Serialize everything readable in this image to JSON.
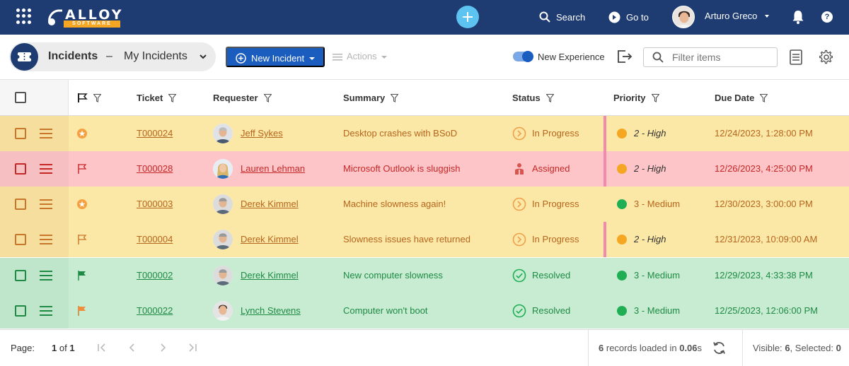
{
  "topbar": {
    "logo_word": "ALLOY",
    "logo_sub": "SOFTWARE",
    "search_label": "Search",
    "goto_label": "Go to",
    "user_name": "Arturo Greco"
  },
  "toolbar": {
    "title": "Incidents",
    "separator": "–",
    "view": "My Incidents",
    "new_button": "New Incident",
    "actions": "Actions",
    "toggle_label": "New Experience",
    "filter_placeholder": "Filter items"
  },
  "columns": [
    "Ticket",
    "Requester",
    "Summary",
    "Status",
    "Priority",
    "Due Date"
  ],
  "rows": [
    {
      "ticket": "T000024",
      "requester": "Jeff Sykes",
      "summary": "Desktop crashes with BSoD",
      "status": "In Progress",
      "priority": "2 - High",
      "due": "12/24/2023, 1:28:00 PM"
    },
    {
      "ticket": "T000028",
      "requester": "Lauren Lehman",
      "summary": "Microsoft Outlook is sluggish",
      "status": "Assigned",
      "priority": "2 - High",
      "due": "12/26/2023, 4:25:00 PM"
    },
    {
      "ticket": "T000003",
      "requester": "Derek Kimmel",
      "summary": "Machine slowness again!",
      "status": "In Progress",
      "priority": "3 - Medium",
      "due": "12/30/2023, 3:00:00 PM"
    },
    {
      "ticket": "T000004",
      "requester": "Derek Kimmel",
      "summary": "Slowness issues have returned",
      "status": "In Progress",
      "priority": "2 - High",
      "due": "12/31/2023, 10:09:00 AM"
    },
    {
      "ticket": "T000002",
      "requester": "Derek Kimmel",
      "summary": "New computer slowness",
      "status": "Resolved",
      "priority": "3 - Medium",
      "due": "12/29/2023, 4:33:38 PM"
    },
    {
      "ticket": "T000022",
      "requester": "Lynch Stevens",
      "summary": "Computer won't boot",
      "status": "Resolved",
      "priority": "3 - Medium",
      "due": "12/25/2023, 12:06:00 PM"
    }
  ],
  "footer": {
    "page_label": "Page:",
    "page_current": "1",
    "page_of": "of",
    "page_total": "1",
    "loaded_count": "6",
    "loaded_mid": "records loaded in",
    "loaded_time": "0.06",
    "loaded_unit": "s",
    "visible_label": "Visible:",
    "visible_count": "6",
    "selected_label": "Selected:",
    "selected_count": "0"
  },
  "colors": {
    "topbar": "#1e3c72",
    "primary_button": "#1a5dbf",
    "row_in_progress": "#fce8a6",
    "row_assigned": "#fdc5c8",
    "row_resolved": "#c7ecd2",
    "priority_high": "#f5a623",
    "priority_medium": "#1fae53"
  }
}
